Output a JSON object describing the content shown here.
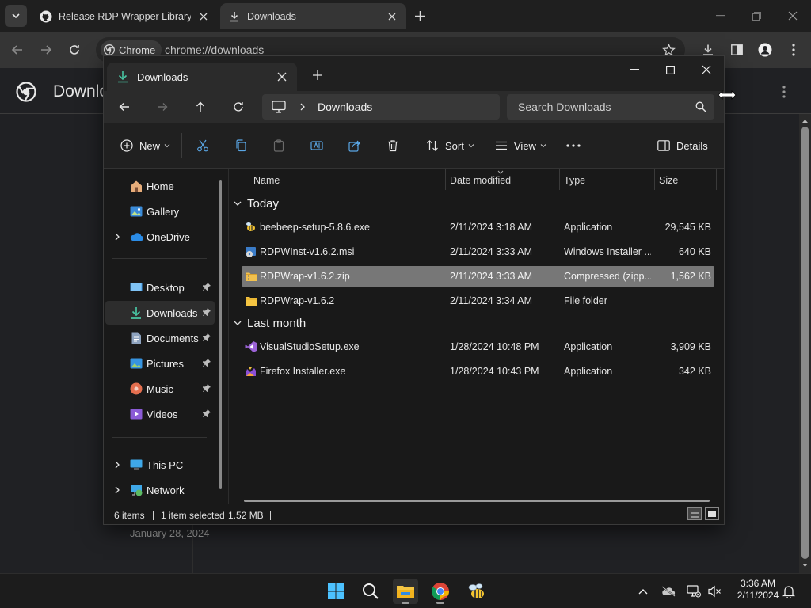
{
  "chrome": {
    "tabs": [
      {
        "title": "Release RDP Wrapper Library v",
        "icon": "github-icon"
      },
      {
        "title": "Downloads",
        "icon": "download-icon"
      }
    ],
    "omnibox": {
      "chip_label": "Chrome",
      "url": "chrome://downloads"
    },
    "page": {
      "title": "Downloads",
      "date_label": "January 28, 2024"
    }
  },
  "explorer": {
    "tab_title": "Downloads",
    "address": {
      "crumb": "Downloads"
    },
    "search_placeholder": "Search Downloads",
    "commands": {
      "new": "New",
      "sort": "Sort",
      "view": "View",
      "details": "Details"
    },
    "nav": [
      {
        "label": "Home",
        "icon": "home-icon"
      },
      {
        "label": "Gallery",
        "icon": "gallery-icon"
      },
      {
        "label": "OneDrive",
        "icon": "onedrive-icon"
      },
      {
        "label": "Desktop",
        "icon": "desktop-icon"
      },
      {
        "label": "Downloads",
        "icon": "download-icon"
      },
      {
        "label": "Documents",
        "icon": "documents-icon"
      },
      {
        "label": "Pictures",
        "icon": "pictures-icon"
      },
      {
        "label": "Music",
        "icon": "music-icon"
      },
      {
        "label": "Videos",
        "icon": "videos-icon"
      },
      {
        "label": "This PC",
        "icon": "this-pc-icon"
      },
      {
        "label": "Network",
        "icon": "network-icon"
      }
    ],
    "columns": {
      "name": "Name",
      "date": "Date modified",
      "type": "Type",
      "size": "Size"
    },
    "groups": [
      {
        "label": "Today",
        "files": [
          {
            "name": "beebeep-setup-5.8.6.exe",
            "date": "2/11/2024 3:18 AM",
            "type": "Application",
            "size": "29,545 KB",
            "icon": "bee-app-icon"
          },
          {
            "name": "RDPWInst-v1.6.2.msi",
            "date": "2/11/2024 3:33 AM",
            "type": "Windows Installer ...",
            "size": "640 KB",
            "icon": "msi-icon"
          },
          {
            "name": "RDPWrap-v1.6.2.zip",
            "date": "2/11/2024 3:33 AM",
            "type": "Compressed (zipp...",
            "size": "1,562 KB",
            "icon": "zip-folder-icon"
          },
          {
            "name": "RDPWrap-v1.6.2",
            "date": "2/11/2024 3:34 AM",
            "type": "File folder",
            "size": "",
            "icon": "folder-icon"
          }
        ]
      },
      {
        "label": "Last month",
        "files": [
          {
            "name": "VisualStudioSetup.exe",
            "date": "1/28/2024 10:48 PM",
            "type": "Application",
            "size": "3,909 KB",
            "icon": "visual-studio-icon"
          },
          {
            "name": "Firefox Installer.exe",
            "date": "1/28/2024 10:43 PM",
            "type": "Application",
            "size": "342 KB",
            "icon": "firefox-icon"
          }
        ]
      }
    ],
    "status": {
      "items": "6 items",
      "selected": "1 item selected",
      "size": "1.52 MB"
    }
  },
  "taskbar": {
    "clock_time": "3:36 AM",
    "clock_date": "2/11/2024"
  }
}
